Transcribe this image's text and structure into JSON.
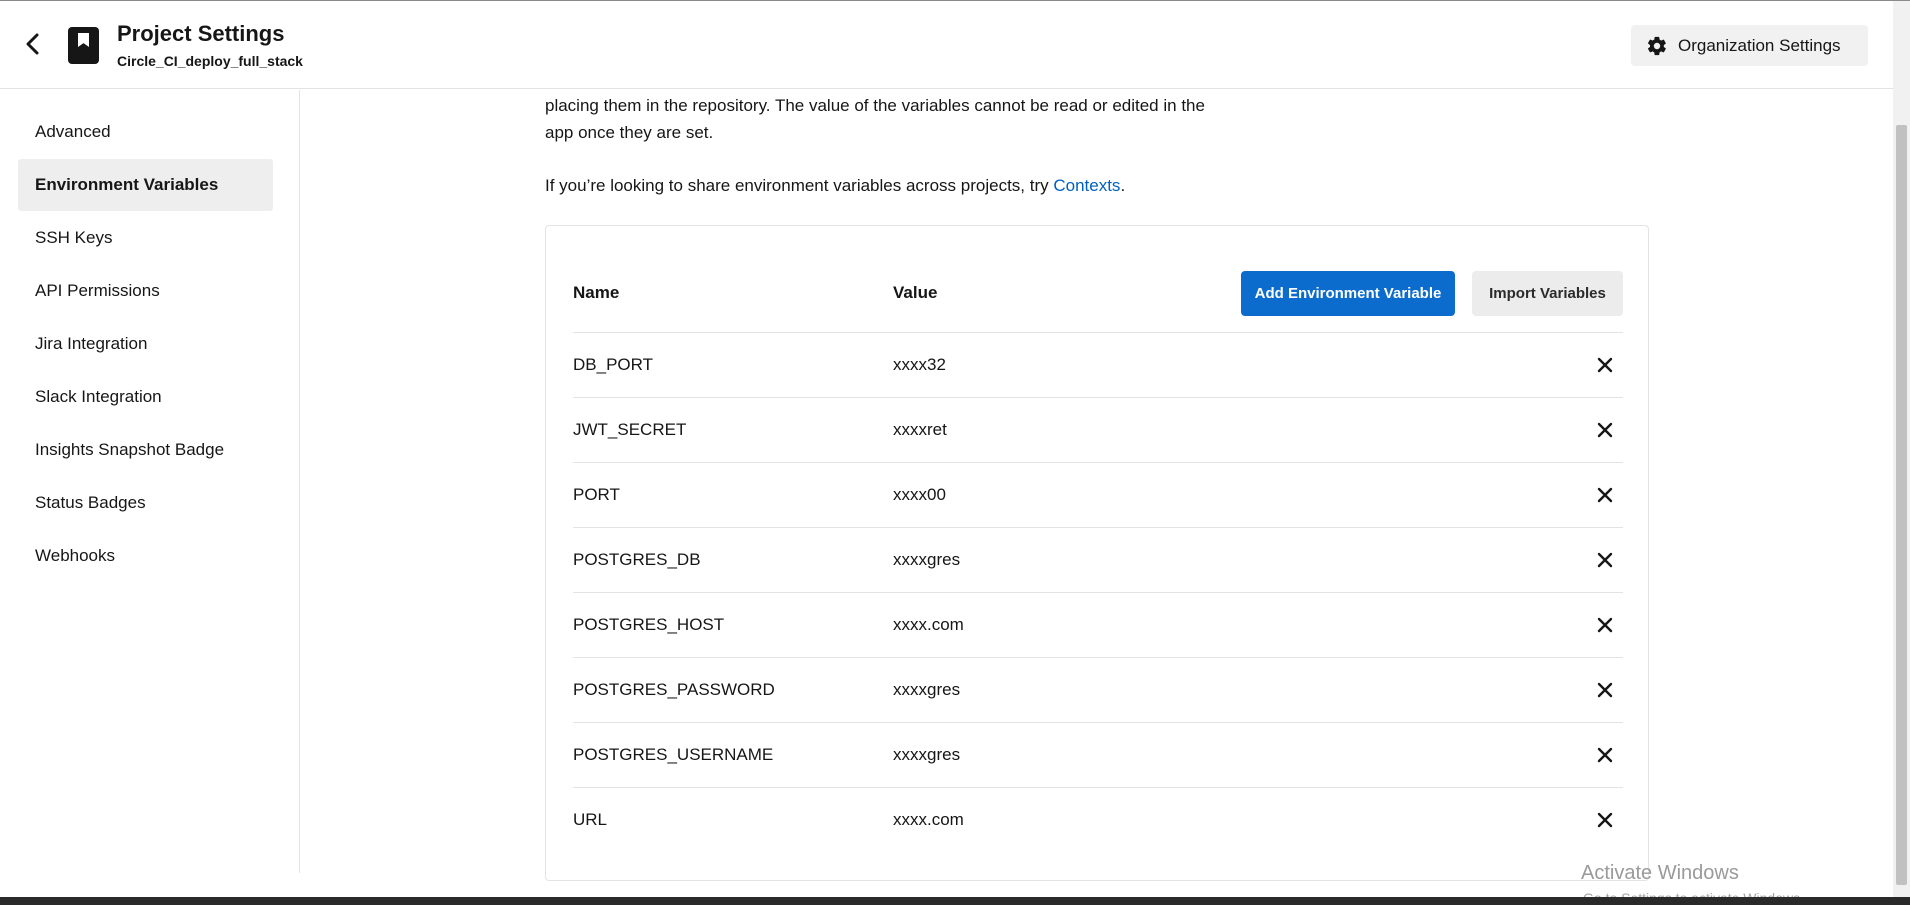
{
  "header": {
    "title": "Project Settings",
    "subtitle": "Circle_CI_deploy_full_stack",
    "org_settings_label": "Organization Settings"
  },
  "sidebar": {
    "items": [
      {
        "label": "Advanced",
        "active": false
      },
      {
        "label": "Environment Variables",
        "active": true
      },
      {
        "label": "SSH Keys",
        "active": false
      },
      {
        "label": "API Permissions",
        "active": false
      },
      {
        "label": "Jira Integration",
        "active": false
      },
      {
        "label": "Slack Integration",
        "active": false
      },
      {
        "label": "Insights Snapshot Badge",
        "active": false
      },
      {
        "label": "Status Badges",
        "active": false
      },
      {
        "label": "Webhooks",
        "active": false
      }
    ]
  },
  "main": {
    "intro_line1": "placing them in the repository. The value of the variables cannot be read or edited in the",
    "intro_line2": "app once they are set.",
    "share_text": "If you’re looking to share environment variables across projects, try ",
    "share_link": "Contexts",
    "share_end": "."
  },
  "table": {
    "col_name": "Name",
    "col_value": "Value",
    "add_button": "Add Environment Variable",
    "import_button": "Import Variables",
    "rows": [
      {
        "name": "DB_PORT",
        "value": "xxxx32"
      },
      {
        "name": "JWT_SECRET",
        "value": "xxxxret"
      },
      {
        "name": "PORT",
        "value": "xxxx00"
      },
      {
        "name": "POSTGRES_DB",
        "value": "xxxxgres"
      },
      {
        "name": "POSTGRES_HOST",
        "value": "xxxx.com"
      },
      {
        "name": "POSTGRES_PASSWORD",
        "value": "xxxxgres"
      },
      {
        "name": "POSTGRES_USERNAME",
        "value": "xxxxgres"
      },
      {
        "name": "URL",
        "value": "xxxx.com"
      }
    ]
  },
  "watermark": {
    "line1": "Activate Windows",
    "line2": "Go to Settings to activate Windows."
  },
  "colors": {
    "accent": "#0b6ccd",
    "link": "#0060c2"
  },
  "icons": {
    "back": "chevron-left-icon",
    "project": "bookmark-icon",
    "org": "gear-icon",
    "delete": "close-icon"
  }
}
